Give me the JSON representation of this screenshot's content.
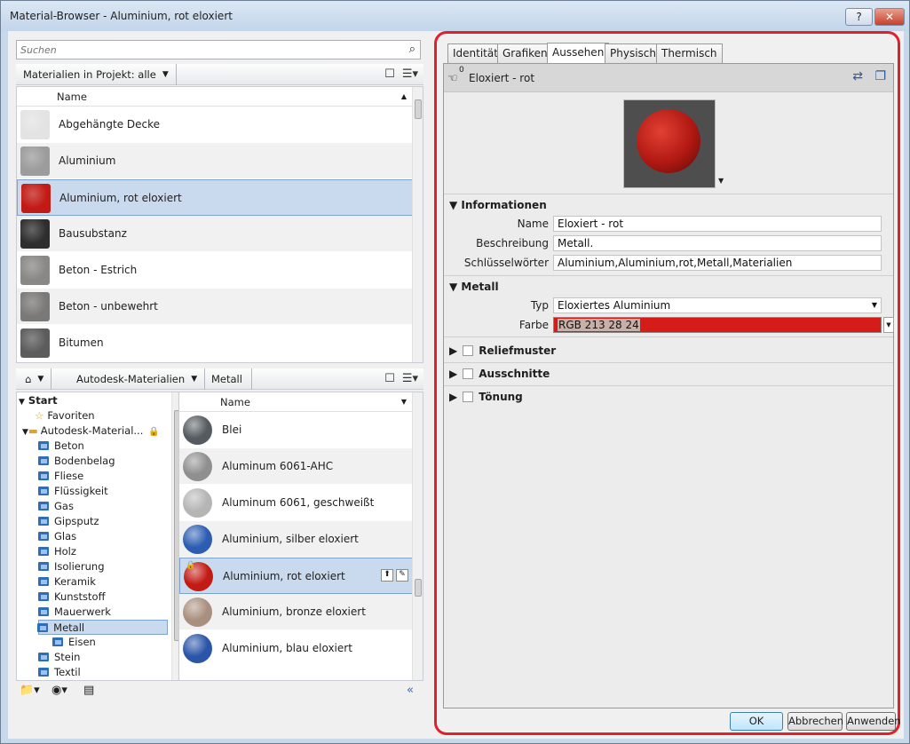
{
  "window": {
    "title": "Material-Browser - Aluminium, rot eloxiert",
    "help": "?",
    "close": "✕"
  },
  "search": {
    "placeholder": "Suchen"
  },
  "project": {
    "crumb": "Materialien in Projekt: alle",
    "column": "Name",
    "items": [
      {
        "label": "Abgehängte Decke",
        "color": "#e3e3e3"
      },
      {
        "label": "Aluminium",
        "color": "#9c9c9c"
      },
      {
        "label": "Aluminium, rot eloxiert",
        "color": "#c21a14"
      },
      {
        "label": "Bausubstanz",
        "color": "#2e2e2e"
      },
      {
        "label": "Beton - Estrich",
        "color": "#8a8885"
      },
      {
        "label": "Beton - unbewehrt",
        "color": "#7b7978"
      },
      {
        "label": "Bitumen",
        "color": "#5c5c5c"
      }
    ]
  },
  "library": {
    "crumbs": [
      "Autodesk-Materialien",
      "Metall"
    ],
    "column": "Name",
    "tree": [
      {
        "label": "Start",
        "indent": 0
      },
      {
        "label": "Favoriten",
        "indent": 1
      },
      {
        "label": "Autodesk-Material...",
        "indent": 1
      },
      {
        "label": "Beton",
        "indent": 2
      },
      {
        "label": "Bodenbelag",
        "indent": 2
      },
      {
        "label": "Fliese",
        "indent": 2
      },
      {
        "label": "Flüssigkeit",
        "indent": 2
      },
      {
        "label": "Gas",
        "indent": 2
      },
      {
        "label": "Gipsputz",
        "indent": 2
      },
      {
        "label": "Glas",
        "indent": 2
      },
      {
        "label": "Holz",
        "indent": 2
      },
      {
        "label": "Isolierung",
        "indent": 2
      },
      {
        "label": "Keramik",
        "indent": 2
      },
      {
        "label": "Kunststoff",
        "indent": 2
      },
      {
        "label": "Mauerwerk",
        "indent": 2
      },
      {
        "label": "Metall",
        "indent": 2
      },
      {
        "label": "Eisen",
        "indent": 3
      },
      {
        "label": "Stein",
        "indent": 2
      },
      {
        "label": "Textil",
        "indent": 2
      }
    ],
    "items": [
      {
        "label": "Blei",
        "color": "#555b60"
      },
      {
        "label": "Aluminum 6061-AHC",
        "color": "#8f8f8f"
      },
      {
        "label": "Aluminum 6061, geschweißt",
        "color": "#b5b5b5"
      },
      {
        "label": "Aluminium, silber eloxiert",
        "color": "#2c5db2"
      },
      {
        "label": "Aluminium, rot eloxiert",
        "color": "#c21a14"
      },
      {
        "label": "Aluminium, bronze eloxiert",
        "color": "#a98f7e"
      },
      {
        "label": "Aluminium, blau eloxiert",
        "color": "#2a55a8"
      }
    ]
  },
  "tabs": [
    "Identität",
    "Grafiken",
    "Aussehen",
    "Physisch",
    "Thermisch"
  ],
  "material": {
    "count": "0",
    "name": "Eloxiert - rot"
  },
  "info": {
    "header": "Informationen",
    "fields": [
      {
        "label": "Name",
        "value": "Eloxiert - rot"
      },
      {
        "label": "Beschreibung",
        "value": "Metall."
      },
      {
        "label": "Schlüsselwörter",
        "value": "Aluminium,Aluminium,rot,Metall,Materialien"
      }
    ]
  },
  "metall": {
    "header": "Metall",
    "typ_label": "Typ",
    "typ_value": "Eloxiertes Aluminium",
    "farbe_label": "Farbe",
    "farbe_value": "RGB 213 28 24",
    "farbe_color": "#d51c18"
  },
  "sections": [
    "Reliefmuster",
    "Ausschnitte",
    "Tönung"
  ],
  "buttons": {
    "ok": "OK",
    "cancel": "Abbrechen",
    "apply": "Anwenden"
  }
}
